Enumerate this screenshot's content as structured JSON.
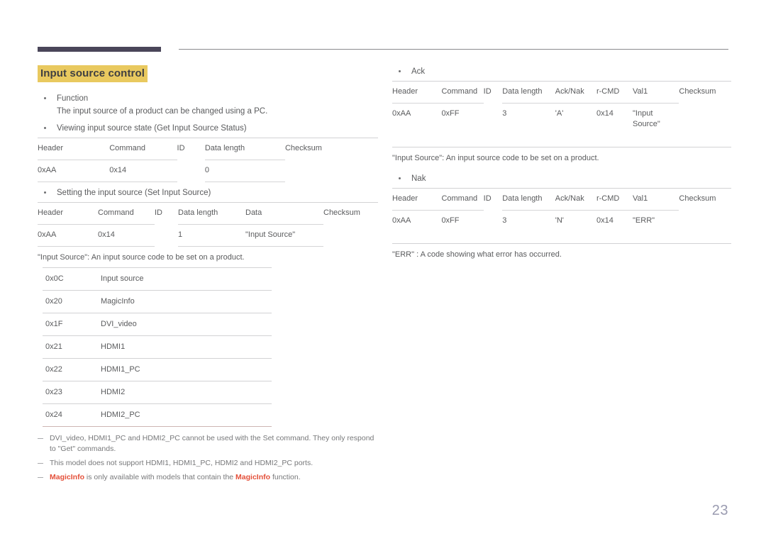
{
  "page": {
    "number": "23",
    "section_title": "Input source control"
  },
  "left": {
    "function_bullet": "Function",
    "function_desc": "The input source of a product can be changed using a PC.",
    "get_bullet": "Viewing input source state (Get Input Source Status)",
    "get_table": {
      "headers": [
        "Header",
        "Command",
        "ID",
        "Data length",
        "Checksum"
      ],
      "rows": [
        [
          "0xAA",
          "0x14",
          "",
          "0",
          ""
        ]
      ]
    },
    "set_bullet": "Setting the input source (Set Input Source)",
    "set_table": {
      "headers": [
        "Header",
        "Command",
        "ID",
        "Data length",
        "Data",
        "Checksum"
      ],
      "rows": [
        [
          "0xAA",
          "0x14",
          "",
          "1",
          "\"Input Source\"",
          ""
        ]
      ]
    },
    "input_source_caption": "\"Input Source\": An input source code to be set on a product.",
    "codes_table": {
      "rows": [
        [
          "0x0C",
          "Input source"
        ],
        [
          "0x20",
          "MagicInfo"
        ],
        [
          "0x1F",
          "DVI_video"
        ],
        [
          "0x21",
          "HDMI1"
        ],
        [
          "0x22",
          "HDMI1_PC"
        ],
        [
          "0x23",
          "HDMI2"
        ],
        [
          "0x24",
          "HDMI2_PC"
        ]
      ]
    },
    "notes": [
      {
        "text": "DVI_video, HDMI1_PC and HDMI2_PC cannot be used with the Set command. They only respond to \"Get\" commands."
      },
      {
        "text": "This model does not support HDMI1, HDMI1_PC, HDMI2 and HDMI2_PC ports."
      },
      {
        "pre": "",
        "hl1": "MagicInfo",
        "mid": " is only available with models that contain the ",
        "hl2": "MagicInfo",
        "post": " function."
      }
    ]
  },
  "right": {
    "ack_bullet": "Ack",
    "ack_table": {
      "headers": [
        "Header",
        "Command",
        "ID",
        "Data length",
        "Ack/Nak",
        "r-CMD",
        "Val1",
        "Checksum"
      ],
      "rows": [
        [
          "0xAA",
          "0xFF",
          "",
          "3",
          "'A'",
          "0x14",
          "\"Input Source\"",
          ""
        ]
      ]
    },
    "ack_caption": "\"Input Source\": An input source code to be set on a product.",
    "nak_bullet": "Nak",
    "nak_table": {
      "headers": [
        "Header",
        "Command",
        "ID",
        "Data length",
        "Ack/Nak",
        "r-CMD",
        "Val1",
        "Checksum"
      ],
      "rows": [
        [
          "0xAA",
          "0xFF",
          "",
          "3",
          "'N'",
          "0x14",
          "\"ERR\"",
          ""
        ]
      ]
    },
    "nak_caption": "\"ERR\" : A code showing what error has occurred."
  },
  "colors": {
    "title_highlight": "#e9c95f",
    "rule_dark": "#4a4659",
    "accent_red": "#e4503a",
    "text_gray": "#5a5b5d",
    "page_number": "#9a9bb0"
  }
}
